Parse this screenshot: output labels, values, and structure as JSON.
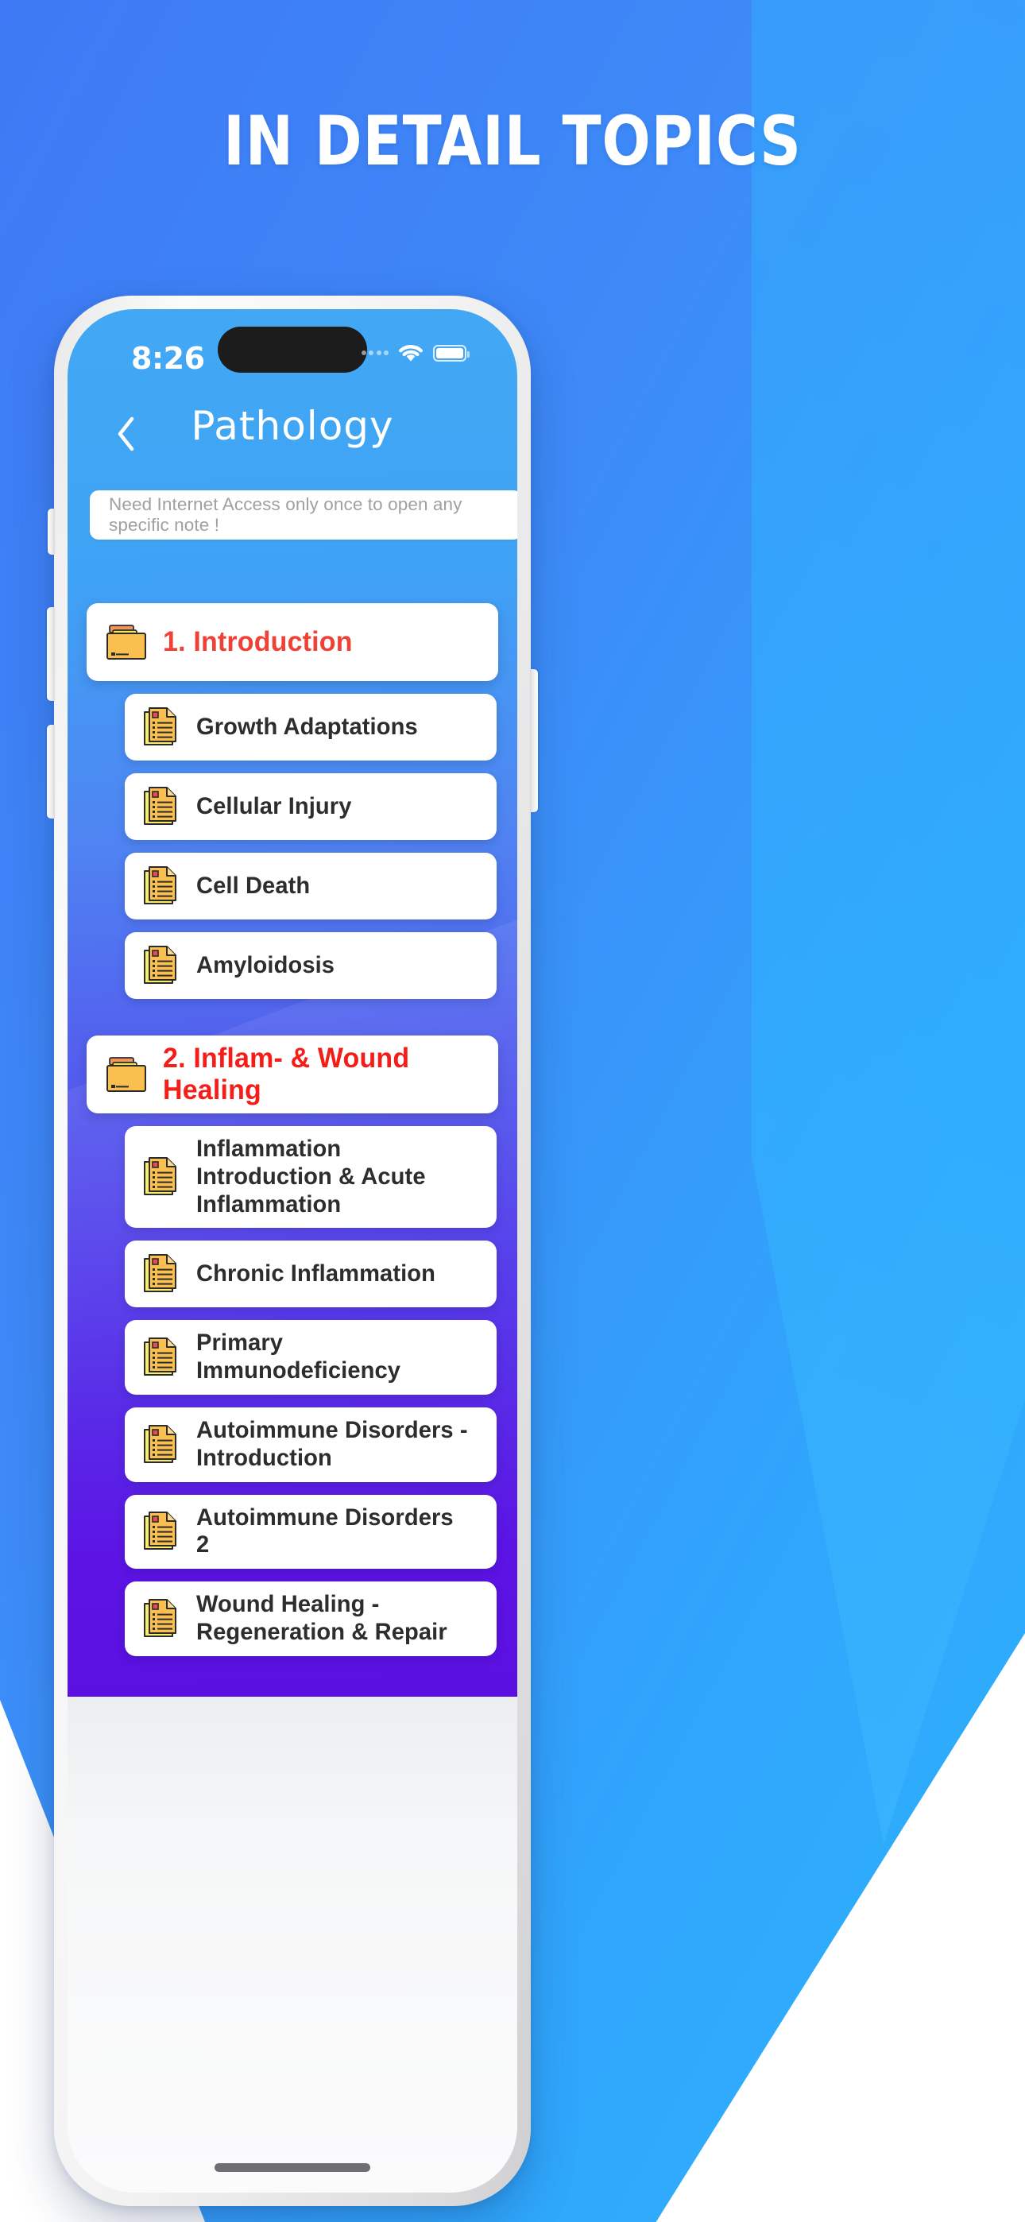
{
  "promo": {
    "headline": "IN DETAIL TOPICS"
  },
  "phone": {
    "status_bar": {
      "time": "8:26",
      "signal_icon": "signal-dots-icon",
      "wifi_icon": "wifi-icon",
      "battery_icon": "battery-icon"
    },
    "nav": {
      "back_icon": "chevron-left-icon",
      "title": "Pathology"
    },
    "info_bar": {
      "message": "Need Internet Access only once to open any specific note !"
    },
    "home_indicator": "home-indicator"
  },
  "sections": [
    {
      "folder_icon": "folder-icon",
      "title": "1. Introduction",
      "title_color": "#ef4136",
      "notes": [
        {
          "icon": "note-icon",
          "title": "Growth Adaptations"
        },
        {
          "icon": "note-icon",
          "title": "Cellular Injury"
        },
        {
          "icon": "note-icon",
          "title": "Cell Death"
        },
        {
          "icon": "note-icon",
          "title": "Amyloidosis"
        }
      ]
    },
    {
      "folder_icon": "folder-icon",
      "title": "2. Inflam- & Wound Healing",
      "title_color": "#f41d18",
      "notes": [
        {
          "icon": "note-icon",
          "title": "Inflammation Introduction & Acute Inflammation"
        },
        {
          "icon": "note-icon",
          "title": "Chronic Inflammation"
        },
        {
          "icon": "note-icon",
          "title": "Primary Immunodeficiency"
        },
        {
          "icon": "note-icon",
          "title": "Autoimmune Disorders - Introduction"
        },
        {
          "icon": "note-icon",
          "title": "Autoimmune Disorders 2"
        },
        {
          "icon": "note-icon",
          "title": "Wound Healing - Regeneration & Repair"
        }
      ]
    }
  ],
  "colors": {
    "promo_bg_start": "#3f79f5",
    "promo_bg_end": "#2eb2fd",
    "app_bg_top": "#42a8f4",
    "app_bg_bottom": "#5a10e0",
    "card_bg": "#ffffff",
    "note_text": "#2d2d2d",
    "placeholder_text": "#9fa0a3"
  }
}
